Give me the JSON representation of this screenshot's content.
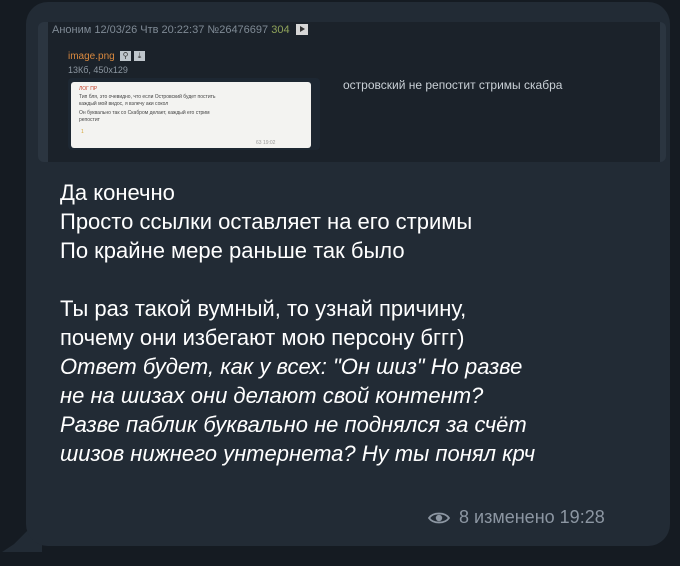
{
  "quoted_post": {
    "author": "Аноним",
    "datetime": "12/03/26 Чтв 20:22:37",
    "post_number": "№26476697",
    "replies": "304",
    "file_name": "image.png",
    "file_info": "13Кб, 450x129",
    "thumbnail_lines": [
      "ЛОГ ПР",
      "Тип бля, это очевидно, что если Островский будет постить",
      "каждый мой видос, я взлечу аки сокол",
      "Он буквально так со Скабром делает, каждый его стрим",
      "репостит",
      "1",
      "63 19:02"
    ],
    "side_text": "островский не репостит стримы скабра",
    "play_icon": "play-icon"
  },
  "message": {
    "lines_normal": [
      "Да конечно",
      "Просто ссылки оставляет на его стримы",
      "По крайне мере раньше так было",
      "",
      "Ты раз такой вумный, то узнай причину,",
      "почему они избегают мою персону бггг)"
    ],
    "lines_italic": [
      "Ответ будет, как у всех: \"Он шиз\" Но разве",
      "не на шизах они делают свой контент?",
      "Разве паблик буквально не поднялся за счёт",
      "шизов нижнего унтернета? Ну ты понял крч"
    ]
  },
  "meta": {
    "icon": "eye-icon",
    "views": "8",
    "edited": "изменено",
    "time": "19:28"
  },
  "colors": {
    "background": "#151b22",
    "bubble": "#222b35",
    "text": "#ffffff",
    "meta": "#8c96a2",
    "filename": "#d9893f",
    "replies": "#8fa35a"
  }
}
